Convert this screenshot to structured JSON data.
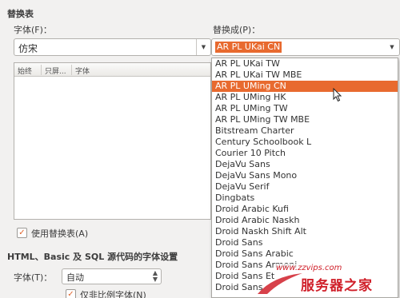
{
  "replacement_table": {
    "section_title": "替换表",
    "font_label": "字体(F)：",
    "font_value": "仿宋",
    "replace_with_label": "替换成(P)：",
    "replace_with_value": "AR PL UKai CN",
    "columns": [
      "始终",
      "只屏...",
      "字体"
    ],
    "use_table_label": "使用替换表(A)",
    "use_table_checked": true
  },
  "source_code_fonts": {
    "section_title": "HTML、Basic 及 SQL 源代码的字体设置",
    "font_label": "字体(T)：",
    "font_value": "自动",
    "proportional_only_label": "仅非比例字体(N)",
    "proportional_only_checked": true
  },
  "font_dropdown": {
    "selected": "AR PL UMing CN",
    "options": [
      "AR PL UKai TW",
      "AR PL UKai TW MBE",
      "AR PL UMing CN",
      "AR PL UMing HK",
      "AR PL UMing TW",
      "AR PL UMing TW MBE",
      "Bitstream Charter",
      "Century Schoolbook L",
      "Courier 10 Pitch",
      "DejaVu Sans",
      "DejaVu Sans Mono",
      "DejaVu Serif",
      "Dingbats",
      "Droid Arabic Kufi",
      "Droid Arabic Naskh",
      "Droid Naskh Shift Alt",
      "Droid Sans",
      "Droid Sans Arabic",
      "Droid Sans Armeni",
      "Droid Sans Et",
      "Droid Sans"
    ]
  },
  "watermark": {
    "url": "www.zzvips.com",
    "brand": "服务器之家"
  },
  "icons": {
    "dropdown_arrow": "chevron-down-icon",
    "checkmark": "checkmark-icon",
    "cursor": "mouse-pointer-icon"
  },
  "colors": {
    "selection": "#e86a2f",
    "watermark": "#d0202a"
  }
}
